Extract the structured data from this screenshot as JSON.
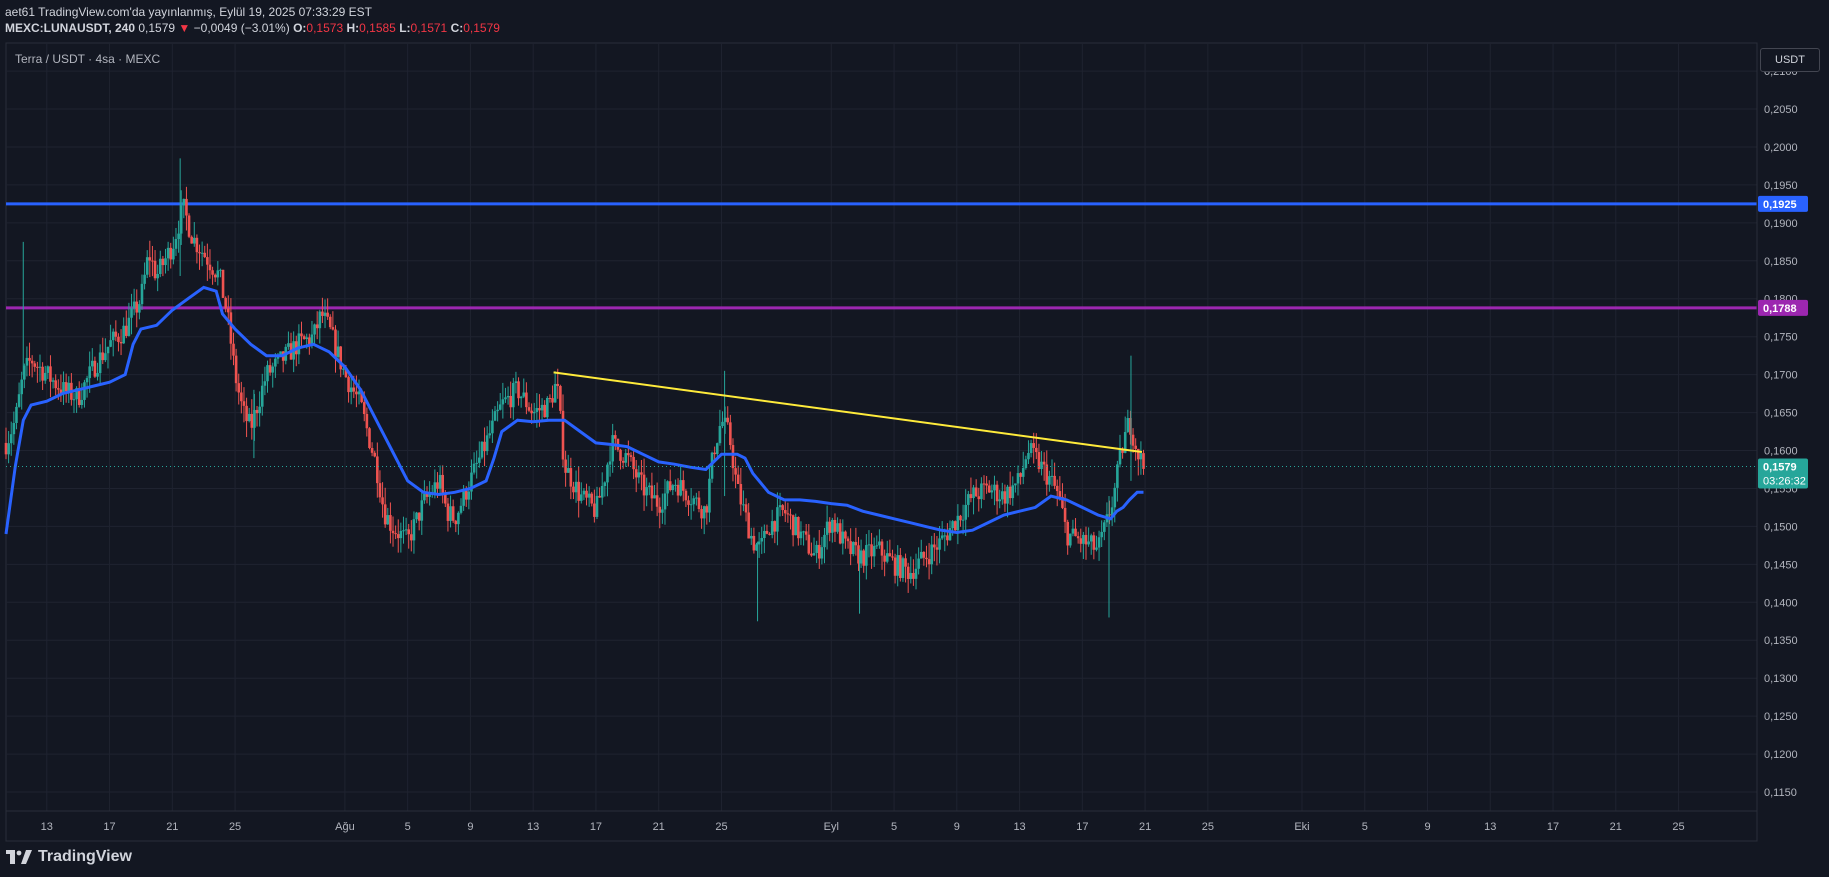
{
  "header": {
    "line1": "aet61 TradingView.com'da yayınlanmış, Eylül 19, 2025 07:33:29 EST",
    "symbol": "MEXC:LUNAUSDT, 240",
    "last": "0,1579",
    "change": "−0,0049 (−3.01%)",
    "o_label": "O:",
    "o_value": "0,1573",
    "h_label": "H:",
    "h_value": "0,1585",
    "l_label": "L:",
    "l_value": "0,1571",
    "c_label": "C:",
    "c_value": "0,1579"
  },
  "pair_label": "Terra / USDT · 4sa · MEXC",
  "currency_button": "USDT",
  "footer": {
    "brand": "TradingView",
    "icon": "tradingview-logo-icon"
  },
  "colors": {
    "background": "#131722",
    "grid": "#1f2330",
    "up": "#26a69a",
    "down": "#ef5350",
    "ma": "#2962ff",
    "resistance": "#2962ff",
    "support": "#9c27b0",
    "trendline": "#ffeb3b"
  },
  "chart_data": {
    "type": "candlestick",
    "symbol": "MEXC:LUNAUSDT",
    "interval": "240",
    "ylim": [
      0.1125,
      0.2137
    ],
    "y_ticks": [
      "0,1150",
      "0,1200",
      "0,1250",
      "0,1300",
      "0,1350",
      "0,1400",
      "0,1450",
      "0,1500",
      "0,1550",
      "0,1600",
      "0,1650",
      "0,1700",
      "0,1750",
      "0,1800",
      "0,1850",
      "0,1900",
      "0,1950",
      "0,2000",
      "0,2050",
      "0,2100"
    ],
    "x_ticks": [
      {
        "label": "13",
        "day": 0
      },
      {
        "label": "17",
        "day": 4
      },
      {
        "label": "21",
        "day": 8
      },
      {
        "label": "25",
        "day": 12
      },
      {
        "label": "Ağu",
        "day": 19
      },
      {
        "label": "5",
        "day": 23
      },
      {
        "label": "9",
        "day": 27
      },
      {
        "label": "13",
        "day": 31
      },
      {
        "label": "17",
        "day": 35
      },
      {
        "label": "21",
        "day": 39
      },
      {
        "label": "25",
        "day": 43
      },
      {
        "label": "Eyl",
        "day": 50
      },
      {
        "label": "5",
        "day": 54
      },
      {
        "label": "9",
        "day": 58
      },
      {
        "label": "13",
        "day": 62
      },
      {
        "label": "17",
        "day": 66
      },
      {
        "label": "21",
        "day": 70
      },
      {
        "label": "25",
        "day": 74
      },
      {
        "label": "Eki",
        "day": 80
      },
      {
        "label": "5",
        "day": 84
      },
      {
        "label": "9",
        "day": 88
      },
      {
        "label": "13",
        "day": 92
      },
      {
        "label": "17",
        "day": 96
      },
      {
        "label": "21",
        "day": 100
      },
      {
        "label": "25",
        "day": 104
      }
    ],
    "x_range_days": [
      -2.6,
      109
    ],
    "last_price": 0.1579,
    "last_price_label": "0,1579",
    "countdown": "03:26:32",
    "horizontal_lines": [
      {
        "price": 0.1925,
        "label": "0,1925",
        "color": "#2962ff"
      },
      {
        "price": 0.1788,
        "label": "0,1788",
        "color": "#9c27b0"
      }
    ],
    "trendline": {
      "start": {
        "day": 32.3,
        "price": 0.1703
      },
      "end": {
        "day": 69.8,
        "price": 0.1598
      },
      "color": "#ffeb3b"
    },
    "price_path": [
      [
        -2.6,
        0.161
      ],
      [
        -2.0,
        0.164
      ],
      [
        -1.5,
        0.17
      ],
      [
        -1.0,
        0.172
      ],
      [
        0,
        0.17
      ],
      [
        1,
        0.168
      ],
      [
        2,
        0.167
      ],
      [
        3,
        0.171
      ],
      [
        4,
        0.174
      ],
      [
        5,
        0.176
      ],
      [
        6,
        0.18
      ],
      [
        6.5,
        0.186
      ],
      [
        7,
        0.183
      ],
      [
        8,
        0.187
      ],
      [
        8.7,
        0.192
      ],
      [
        9.3,
        0.188
      ],
      [
        10,
        0.186
      ],
      [
        11,
        0.183
      ],
      [
        11.5,
        0.178
      ],
      [
        12,
        0.17
      ],
      [
        12.5,
        0.165
      ],
      [
        13,
        0.163
      ],
      [
        14,
        0.17
      ],
      [
        15,
        0.172
      ],
      [
        16,
        0.174
      ],
      [
        17,
        0.175
      ],
      [
        17.5,
        0.178
      ],
      [
        18,
        0.176
      ],
      [
        19,
        0.17
      ],
      [
        20,
        0.166
      ],
      [
        20.5,
        0.162
      ],
      [
        21,
        0.158
      ],
      [
        21.5,
        0.152
      ],
      [
        22,
        0.15
      ],
      [
        23,
        0.148
      ],
      [
        24,
        0.153
      ],
      [
        25,
        0.156
      ],
      [
        25.5,
        0.152
      ],
      [
        26,
        0.151
      ],
      [
        27,
        0.156
      ],
      [
        28,
        0.161
      ],
      [
        29,
        0.166
      ],
      [
        30,
        0.168
      ],
      [
        31,
        0.165
      ],
      [
        32,
        0.166
      ],
      [
        32.5,
        0.169
      ],
      [
        33,
        0.158
      ],
      [
        34,
        0.154
      ],
      [
        35,
        0.152
      ],
      [
        35.5,
        0.156
      ],
      [
        36,
        0.161
      ],
      [
        37,
        0.159
      ],
      [
        38,
        0.155
      ],
      [
        39,
        0.153
      ],
      [
        40,
        0.156
      ],
      [
        41,
        0.154
      ],
      [
        42,
        0.152
      ],
      [
        42.5,
        0.16
      ],
      [
        43,
        0.164
      ],
      [
        43.5,
        0.162
      ],
      [
        44,
        0.155
      ],
      [
        45,
        0.148
      ],
      [
        45.5,
        0.147
      ],
      [
        46,
        0.15
      ],
      [
        47,
        0.152
      ],
      [
        48,
        0.149
      ],
      [
        49,
        0.146
      ],
      [
        50,
        0.151
      ],
      [
        51,
        0.147
      ],
      [
        52,
        0.146
      ],
      [
        53,
        0.147
      ],
      [
        54,
        0.145
      ],
      [
        55,
        0.144
      ],
      [
        56,
        0.146
      ],
      [
        57,
        0.148
      ],
      [
        58,
        0.151
      ],
      [
        59,
        0.154
      ],
      [
        60,
        0.155
      ],
      [
        61,
        0.154
      ],
      [
        62,
        0.156
      ],
      [
        62.5,
        0.16
      ],
      [
        63,
        0.159
      ],
      [
        64,
        0.156
      ],
      [
        64.5,
        0.154
      ],
      [
        65,
        0.149
      ],
      [
        66,
        0.148
      ],
      [
        67,
        0.147
      ],
      [
        67.5,
        0.15
      ],
      [
        68,
        0.154
      ],
      [
        68.5,
        0.16
      ],
      [
        69,
        0.164
      ],
      [
        69.5,
        0.16
      ],
      [
        69.9,
        0.1579
      ]
    ],
    "ma_path": [
      [
        -2.6,
        0.149
      ],
      [
        -2.0,
        0.158
      ],
      [
        -1.5,
        0.164
      ],
      [
        -1.0,
        0.166
      ],
      [
        0,
        0.1665
      ],
      [
        1,
        0.1675
      ],
      [
        2,
        0.168
      ],
      [
        3,
        0.1685
      ],
      [
        4,
        0.169
      ],
      [
        5,
        0.17
      ],
      [
        5.5,
        0.174
      ],
      [
        6,
        0.176
      ],
      [
        7,
        0.1765
      ],
      [
        8,
        0.1785
      ],
      [
        9,
        0.18
      ],
      [
        10,
        0.1815
      ],
      [
        10.8,
        0.181
      ],
      [
        11.2,
        0.178
      ],
      [
        12,
        0.176
      ],
      [
        13,
        0.174
      ],
      [
        14,
        0.1725
      ],
      [
        15,
        0.1725
      ],
      [
        16,
        0.1735
      ],
      [
        17,
        0.174
      ],
      [
        18,
        0.173
      ],
      [
        19,
        0.171
      ],
      [
        20,
        0.168
      ],
      [
        21,
        0.164
      ],
      [
        22,
        0.16
      ],
      [
        23,
        0.156
      ],
      [
        24,
        0.1545
      ],
      [
        25,
        0.1542
      ],
      [
        26,
        0.1545
      ],
      [
        27,
        0.155
      ],
      [
        28,
        0.156
      ],
      [
        28.5,
        0.159
      ],
      [
        29,
        0.1625
      ],
      [
        30,
        0.164
      ],
      [
        31,
        0.1638
      ],
      [
        32,
        0.164
      ],
      [
        33,
        0.164
      ],
      [
        34,
        0.1625
      ],
      [
        35,
        0.161
      ],
      [
        36,
        0.1608
      ],
      [
        37,
        0.1605
      ],
      [
        38,
        0.1595
      ],
      [
        39,
        0.1585
      ],
      [
        40,
        0.1582
      ],
      [
        41,
        0.1578
      ],
      [
        42,
        0.1575
      ],
      [
        43,
        0.1595
      ],
      [
        44,
        0.1595
      ],
      [
        44.5,
        0.159
      ],
      [
        45,
        0.157
      ],
      [
        46,
        0.1545
      ],
      [
        47,
        0.1535
      ],
      [
        48,
        0.1535
      ],
      [
        49,
        0.1533
      ],
      [
        50,
        0.153
      ],
      [
        51,
        0.1528
      ],
      [
        52,
        0.152
      ],
      [
        53,
        0.1515
      ],
      [
        54,
        0.151
      ],
      [
        55,
        0.1505
      ],
      [
        56,
        0.15
      ],
      [
        57,
        0.1495
      ],
      [
        58,
        0.1492
      ],
      [
        59,
        0.1495
      ],
      [
        60,
        0.1505
      ],
      [
        61,
        0.1515
      ],
      [
        62,
        0.152
      ],
      [
        63,
        0.1525
      ],
      [
        64,
        0.154
      ],
      [
        65,
        0.1535
      ],
      [
        66,
        0.1525
      ],
      [
        67,
        0.1515
      ],
      [
        67.8,
        0.151
      ],
      [
        68.2,
        0.152
      ],
      [
        68.6,
        0.1525
      ],
      [
        69,
        0.1535
      ],
      [
        69.5,
        0.1545
      ],
      [
        69.9,
        0.1545
      ]
    ],
    "spikes": [
      {
        "day": 8.5,
        "high": 0.1985,
        "low": 0.183
      },
      {
        "day": -1.5,
        "high": 0.1875,
        "low": 0.17
      },
      {
        "day": 13.2,
        "high": 0.168,
        "low": 0.159
      },
      {
        "day": 43.2,
        "high": 0.1705,
        "low": 0.154
      },
      {
        "day": 45.3,
        "high": 0.148,
        "low": 0.1375
      },
      {
        "day": 51.8,
        "high": 0.147,
        "low": 0.1385
      },
      {
        "day": 67.7,
        "high": 0.154,
        "low": 0.138
      },
      {
        "day": 69.1,
        "high": 0.1725,
        "low": 0.156
      }
    ]
  }
}
